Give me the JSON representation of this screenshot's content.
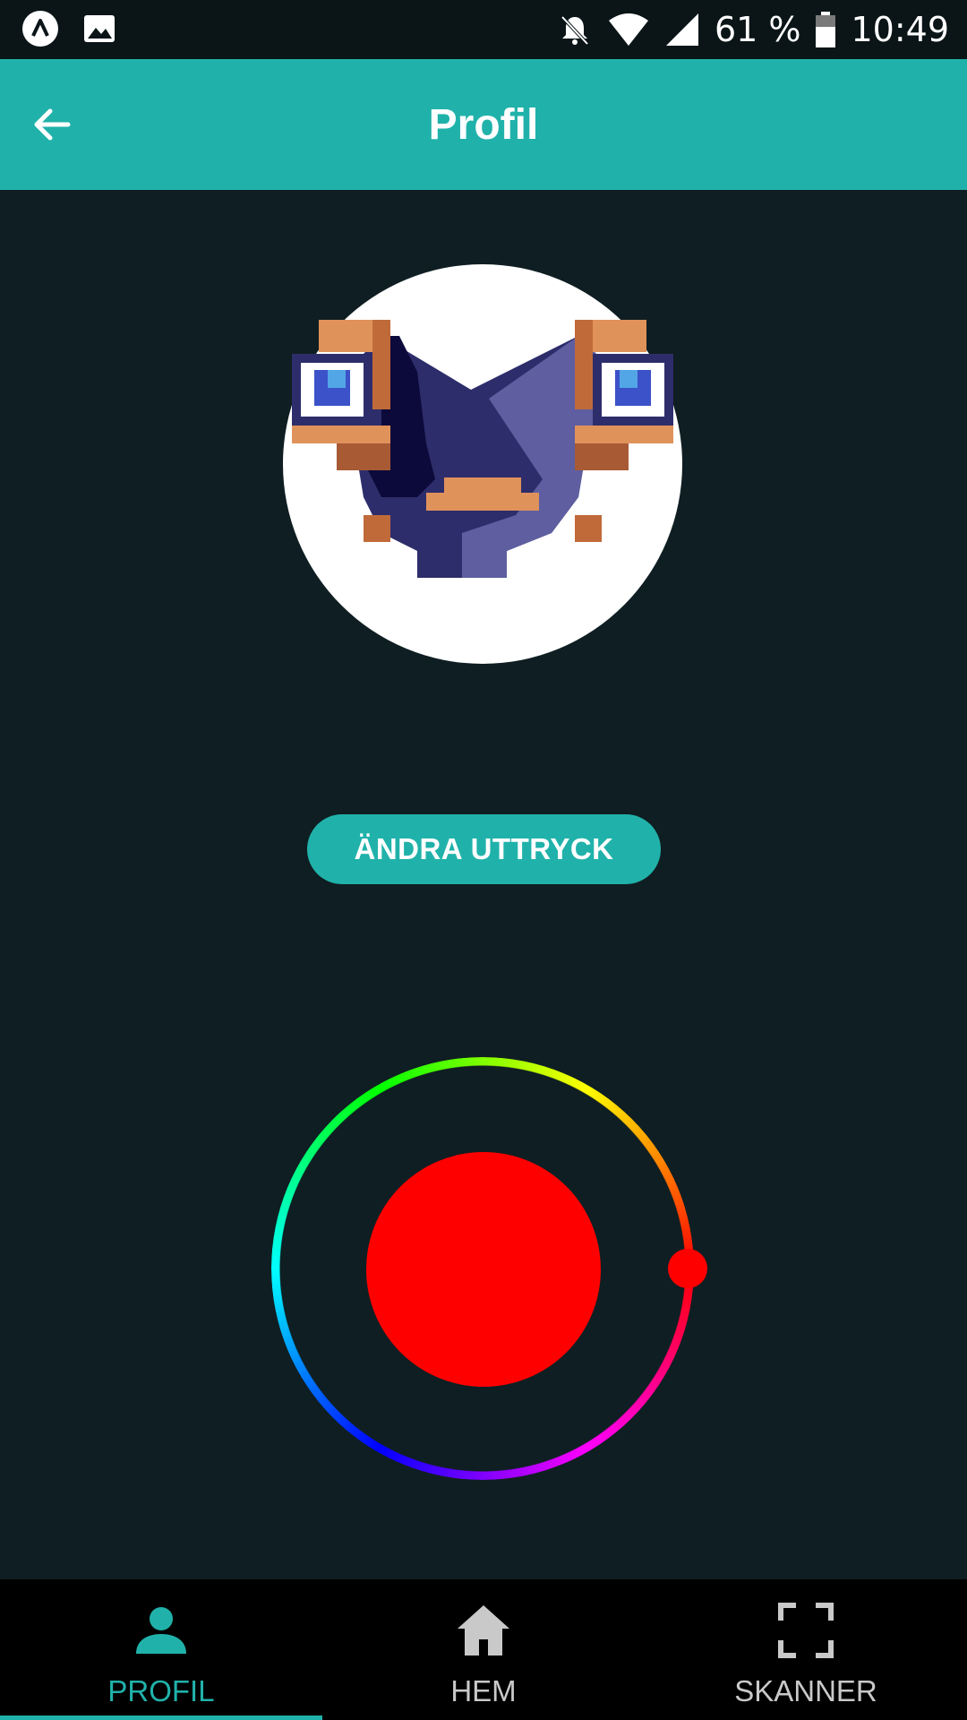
{
  "status_bar": {
    "battery": "61 %",
    "time": "10:49",
    "icons": [
      "app-logo-icon",
      "image-icon",
      "notifications-off-icon",
      "wifi-icon",
      "signal-icon",
      "battery-icon"
    ]
  },
  "app_bar": {
    "title": "Profil",
    "back_icon": "arrow-left-icon"
  },
  "avatar": {
    "description_icon": "pixel-frog-avatar"
  },
  "expression_button": {
    "label": "ÄNDRA UTTRYCK"
  },
  "color_picker": {
    "selected_color": "#ff0000",
    "hue_degrees": 0
  },
  "bottom_nav": {
    "items": [
      {
        "label": "PROFIL",
        "icon": "person-icon",
        "active": true
      },
      {
        "label": "HEM",
        "icon": "home-icon",
        "active": false
      },
      {
        "label": "SKANNER",
        "icon": "scan-frame-icon",
        "active": false
      }
    ]
  },
  "colors": {
    "accent": "#20b2aa",
    "background": "#0f1e22"
  }
}
